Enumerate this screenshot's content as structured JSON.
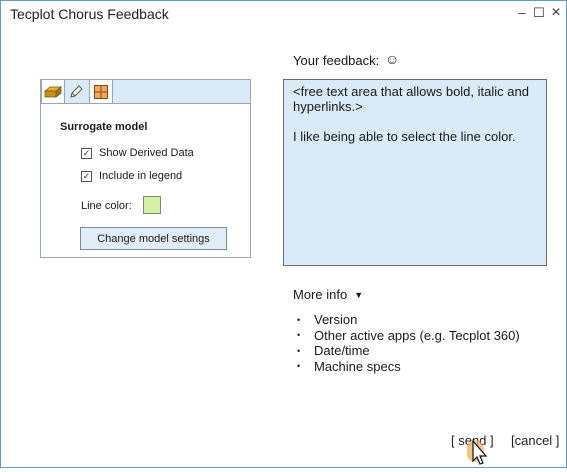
{
  "window": {
    "title": "Tecplot Chorus Feedback",
    "min_glyph": "–",
    "max_glyph": "☐",
    "close_glyph": "×"
  },
  "preview": {
    "heading": "Surrogate model",
    "checks": [
      {
        "label": "Show Derived Data",
        "checked": true
      },
      {
        "label": "Include in legend",
        "checked": true
      }
    ],
    "line_color_label": "Line color:",
    "line_color": "#d3f2a3",
    "change_button": "Change model settings",
    "tools": [
      "eraser-icon",
      "pencil-icon",
      "grid-layout-icon"
    ]
  },
  "feedback": {
    "label": "Your feedback:",
    "emoji": "☺",
    "line1": "<free text area that allows bold, italic and hyperlinks.>",
    "line2": "I like being able to select the line color."
  },
  "more_info": {
    "label": "More info",
    "items": [
      "Version",
      "Other active apps (e.g. Tecplot 360)",
      "Date/time",
      "Machine specs"
    ]
  },
  "actions": {
    "send": "[ send ]",
    "cancel": "[cancel ]"
  }
}
